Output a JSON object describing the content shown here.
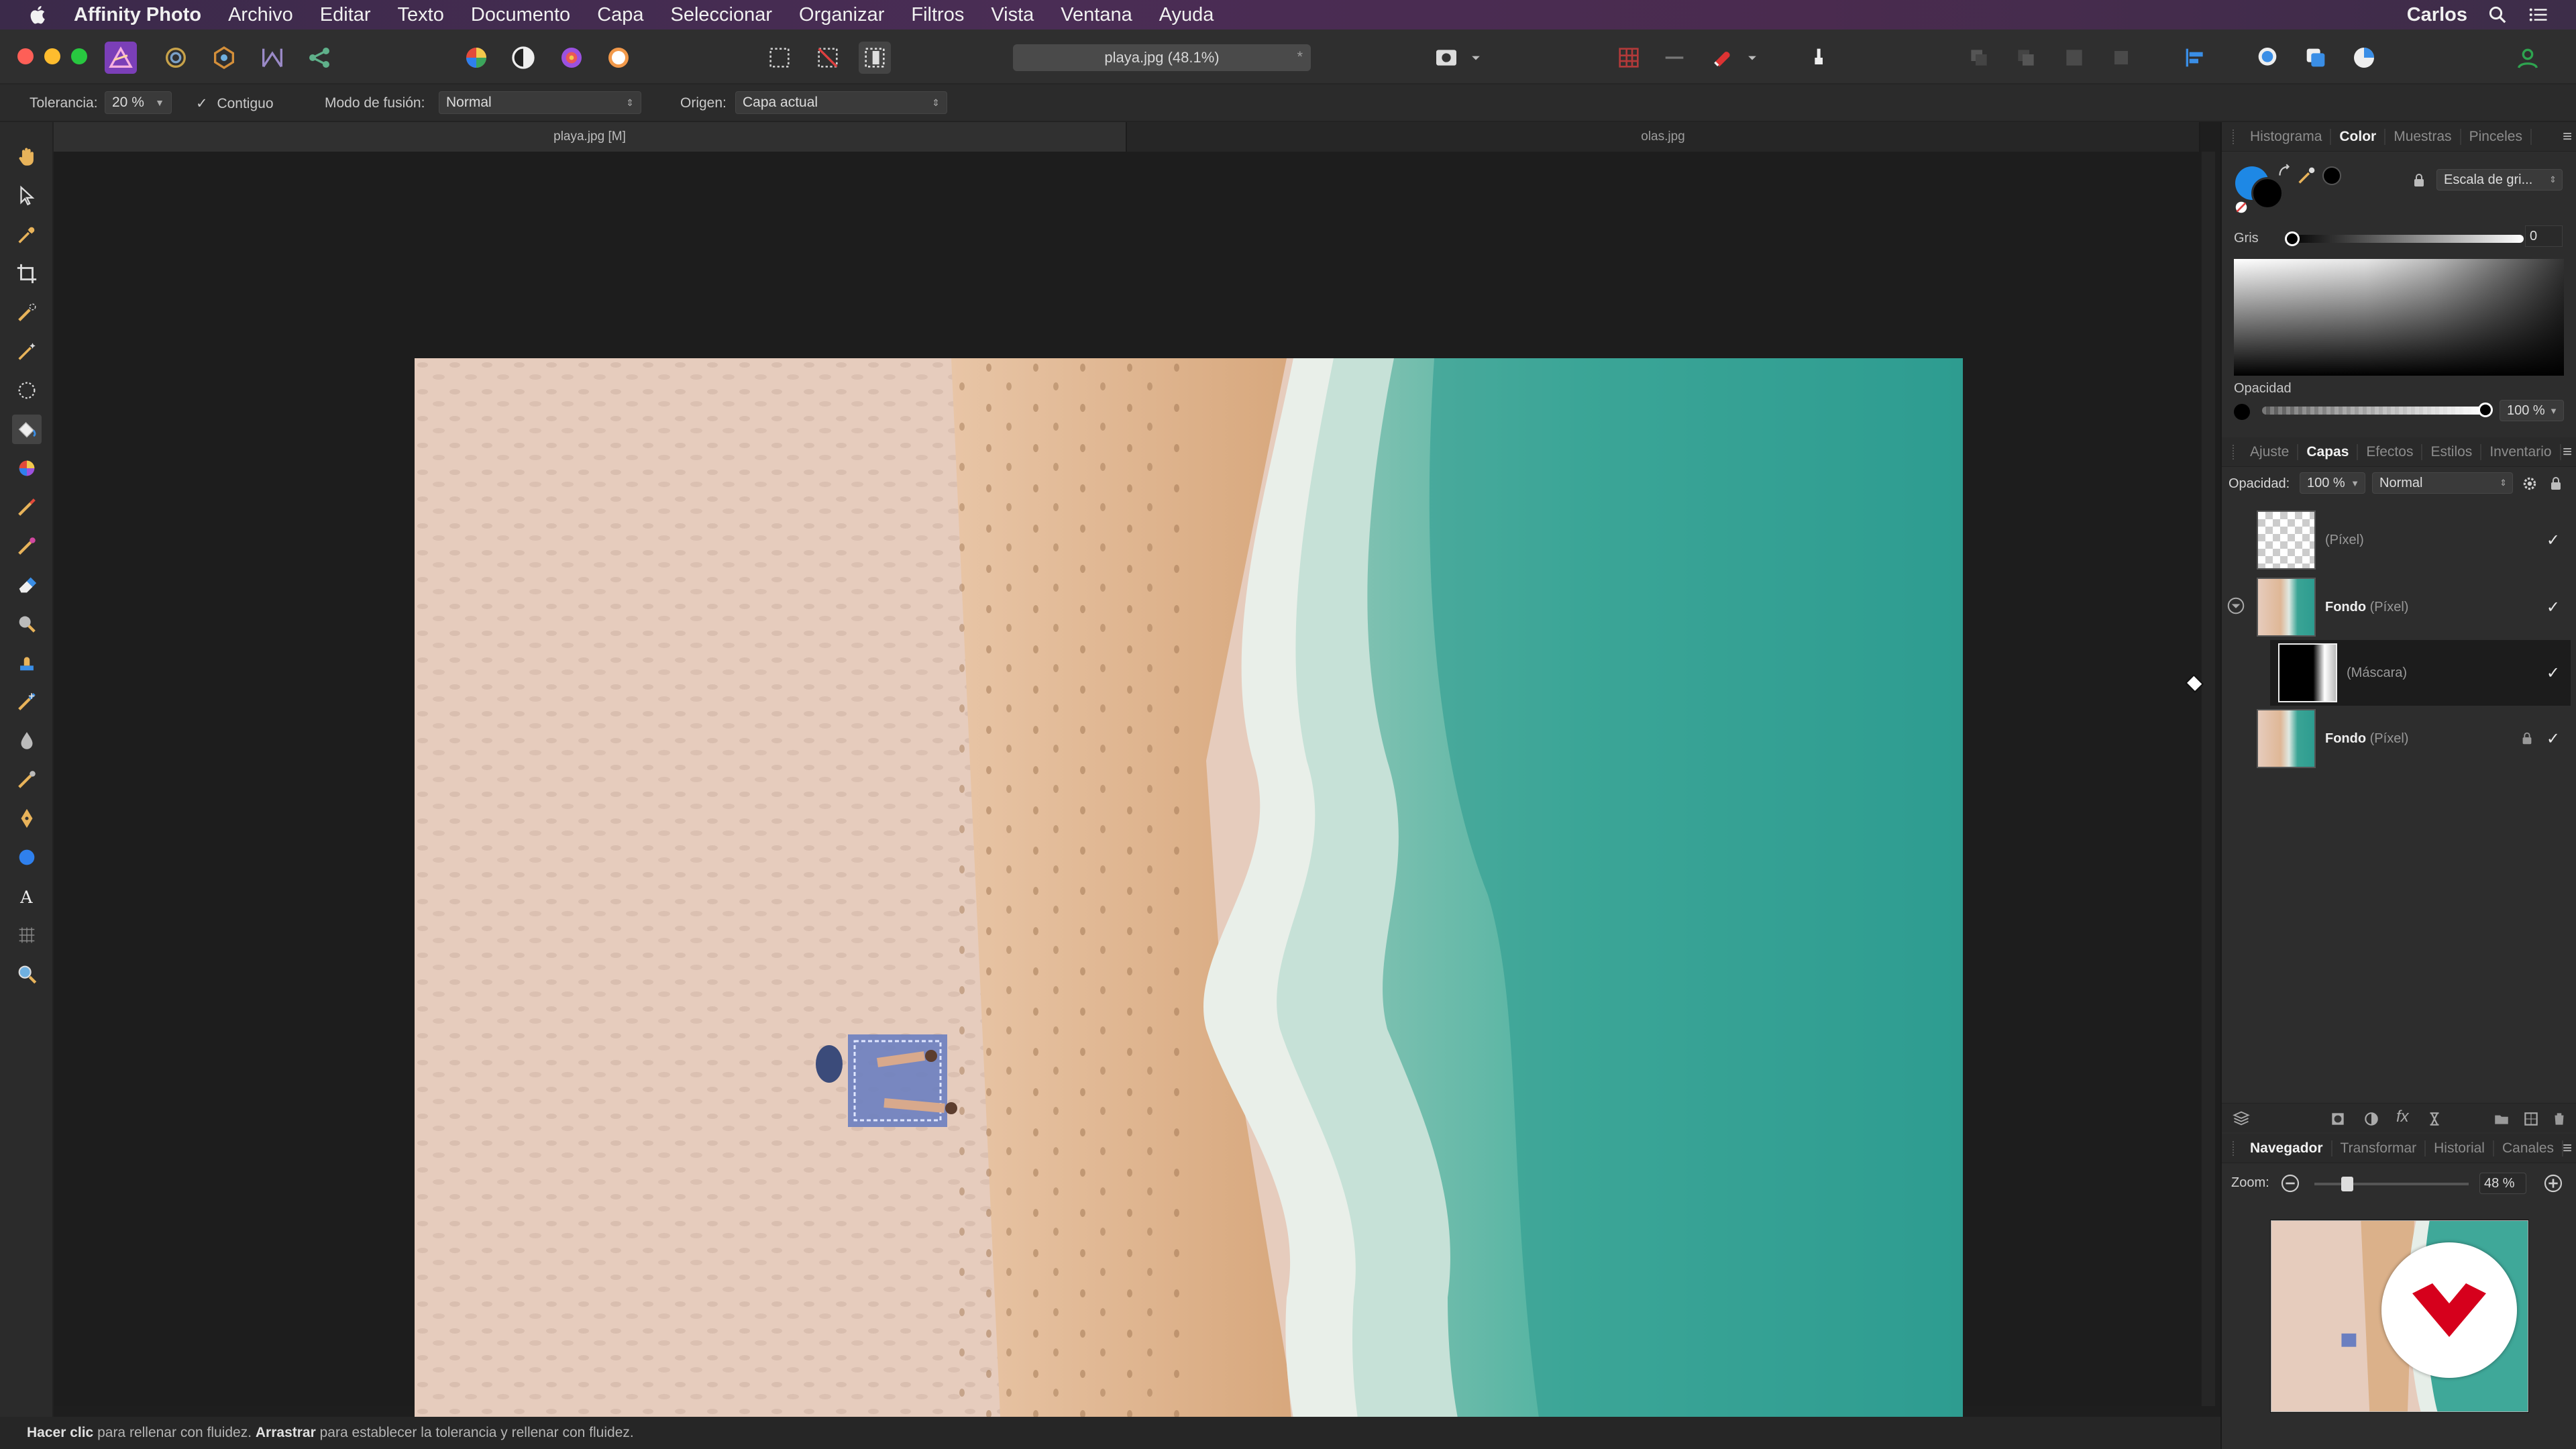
{
  "menubar": {
    "app_name": "Affinity Photo",
    "items": [
      "Archivo",
      "Editar",
      "Texto",
      "Documento",
      "Capa",
      "Seleccionar",
      "Organizar",
      "Filtros",
      "Vista",
      "Ventana",
      "Ayuda"
    ],
    "user": "Carlos",
    "icons": [
      "apple-icon",
      "search-icon",
      "menu-list-icon"
    ]
  },
  "toolbar": {
    "document_title": "playa.jpg (48.1%)",
    "modified_star": "*"
  },
  "context_bar": {
    "tolerance_label": "Tolerancia:",
    "tolerance_value": "20 %",
    "contiguous_label": "Contiguo",
    "contiguous_checked": true,
    "blend_label": "Modo de fusión:",
    "blend_value": "Normal",
    "source_label": "Origen:",
    "source_value": "Capa actual"
  },
  "doc_tabs": [
    {
      "label": "playa.jpg [M]",
      "active": true
    },
    {
      "label": "olas.jpg",
      "active": false
    }
  ],
  "status": {
    "click_bold": "Hacer clic",
    "click_text": " para rellenar con fluidez. ",
    "drag_bold": "Arrastrar",
    "drag_text": " para establecer la tolerancia y rellenar con fluidez."
  },
  "color_panel": {
    "tabs": [
      "Histograma",
      "Color",
      "Muestras",
      "Pinceles"
    ],
    "active_tab": "Color",
    "model_value": "Escala de gri...",
    "gray_label": "Gris",
    "gray_value": "0",
    "opacity_label": "Opacidad",
    "opacity_value": "100 %",
    "fill_color": "#1e88e5"
  },
  "layers_panel": {
    "tabs": [
      "Ajuste",
      "Capas",
      "Efectos",
      "Estilos",
      "Inventario"
    ],
    "active_tab": "Capas",
    "opacity_label": "Opacidad:",
    "opacity_value": "100 %",
    "blend_value": "Normal",
    "layers": [
      {
        "name": "",
        "type": "(Píxel)",
        "checked": "✓"
      },
      {
        "name": "Fondo",
        "type": " (Píxel)",
        "checked": "✓"
      },
      {
        "name": "",
        "type": "(Máscara)",
        "checked": "✓"
      },
      {
        "name": "Fondo",
        "type": " (Píxel)",
        "checked": "✓"
      }
    ]
  },
  "navigator_panel": {
    "tabs": [
      "Navegador",
      "Transformar",
      "Historial",
      "Canales"
    ],
    "active_tab": "Navegador",
    "zoom_label": "Zoom:",
    "zoom_value": "48 %",
    "zoom_level": 0.48
  }
}
